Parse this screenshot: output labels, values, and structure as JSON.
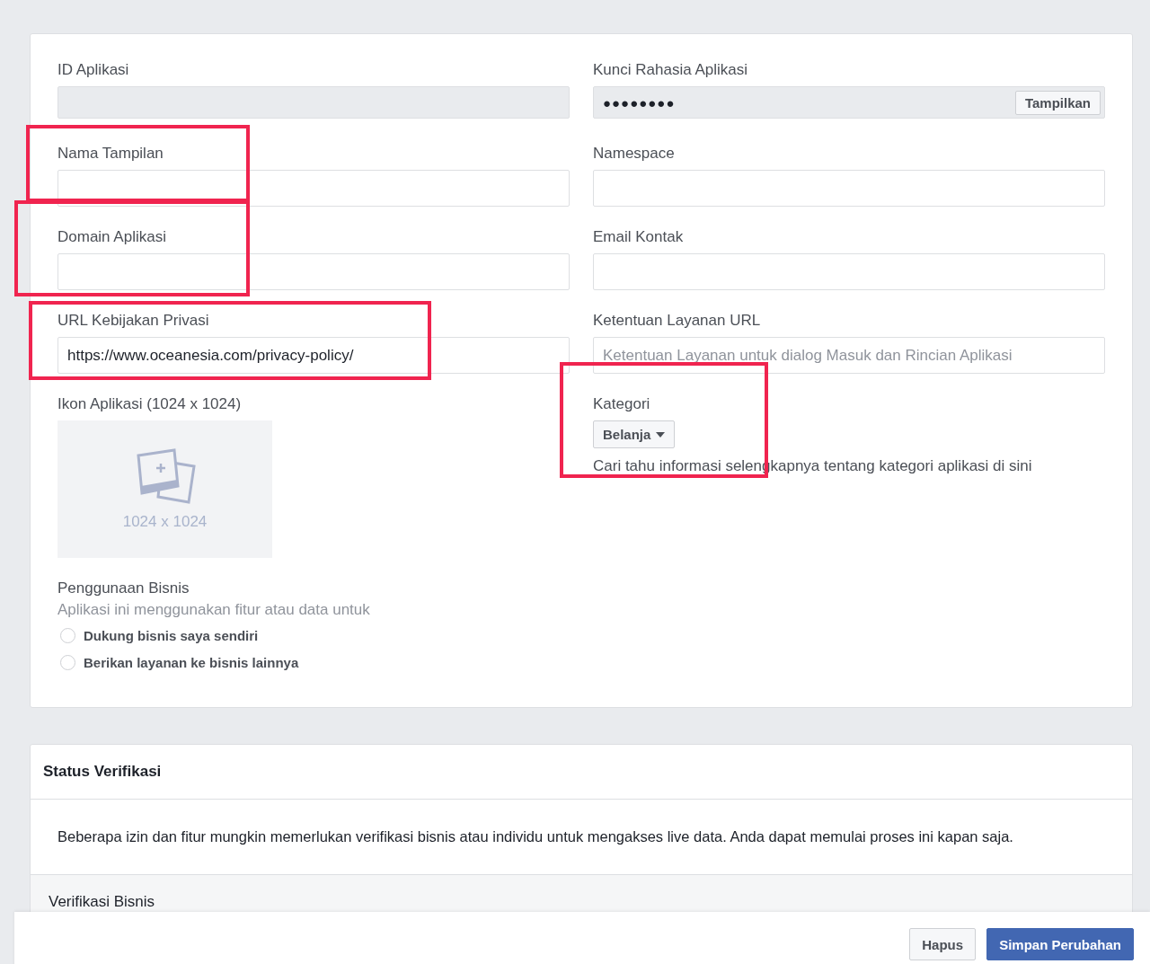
{
  "basic_settings": {
    "left_fields": [
      {
        "label": "ID Aplikasi",
        "kind": "readonly",
        "highlighted": false
      },
      {
        "label": "Nama Tampilan",
        "kind": "text",
        "highlighted": true
      },
      {
        "label": "Domain Aplikasi",
        "kind": "text",
        "highlighted": true
      },
      {
        "label": "URL Kebijakan Privasi",
        "kind": "text",
        "value": "https://www.oceanesia.com/privacy-policy/",
        "highlighted": true
      }
    ],
    "right_fields": [
      {
        "label": "Kunci Rahasia Aplikasi",
        "kind": "secret",
        "value": "●●●●●●●●",
        "button": "Tampilkan",
        "highlighted": false
      },
      {
        "label": "Namespace",
        "kind": "text",
        "highlighted": false
      },
      {
        "label": "Email Kontak",
        "kind": "text",
        "highlighted": false
      },
      {
        "label": "Ketentuan Layanan URL",
        "kind": "text",
        "placeholder": "Ketentuan Layanan untuk dialog Masuk dan Rincian Aplikasi",
        "highlighted": false
      }
    ],
    "app_icon": {
      "label": "Ikon Aplikasi (1024 x 1024)",
      "size_hint": "1024 x 1024"
    },
    "category": {
      "label": "Kategori",
      "value": "Belanja",
      "help": "Cari tahu informasi selengkapnya tentang kategori aplikasi di sini",
      "highlighted": true
    },
    "business_use": {
      "label": "Penggunaan Bisnis",
      "description": "Aplikasi ini menggunakan fitur atau data untuk",
      "options": [
        {
          "label": "Dukung bisnis saya sendiri",
          "selected": false
        },
        {
          "label": "Berikan layanan ke bisnis lainnya",
          "selected": false
        }
      ]
    }
  },
  "verification": {
    "title": "Status Verifikasi",
    "text": "Beberapa izin dan fitur mungkin memerlukan verifikasi bisnis atau individu untuk mengakses live data. Anda dapat memulai proses ini kapan saja.",
    "section": "Verifikasi Bisnis"
  },
  "footer": {
    "buttons": [
      {
        "label": "Hapus",
        "kind": "secondary"
      },
      {
        "label": "Simpan Perubahan",
        "kind": "primary"
      }
    ]
  }
}
